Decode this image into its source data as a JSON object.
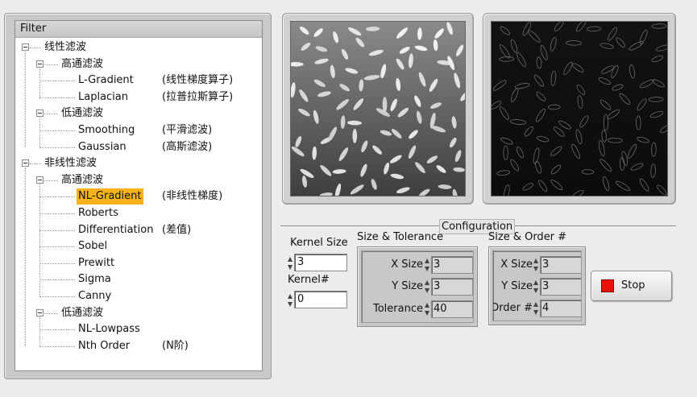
{
  "filter": {
    "header": "Filter",
    "tree": [
      {
        "level": 0,
        "label": "线性滤波",
        "desc": "",
        "expander": true,
        "selected": false
      },
      {
        "level": 1,
        "label": "高通滤波",
        "desc": "",
        "expander": true,
        "selected": false
      },
      {
        "level": 2,
        "label": "L-Gradient",
        "desc": "(线性梯度算子)",
        "expander": false,
        "selected": false
      },
      {
        "level": 2,
        "label": "Laplacian",
        "desc": "(拉普拉斯算子)",
        "expander": false,
        "selected": false
      },
      {
        "level": 1,
        "label": "低通滤波",
        "desc": "",
        "expander": true,
        "selected": false
      },
      {
        "level": 2,
        "label": "Smoothing",
        "desc": "(平滑滤波)",
        "expander": false,
        "selected": false
      },
      {
        "level": 2,
        "label": "Gaussian",
        "desc": "(高斯滤波)",
        "expander": false,
        "selected": false
      },
      {
        "level": 0,
        "label": "非线性滤波",
        "desc": "",
        "expander": true,
        "selected": false
      },
      {
        "level": 1,
        "label": "高通滤波",
        "desc": "",
        "expander": true,
        "selected": false
      },
      {
        "level": 2,
        "label": "NL-Gradient",
        "desc": "(非线性梯度)",
        "expander": false,
        "selected": true
      },
      {
        "level": 2,
        "label": "Roberts",
        "desc": "",
        "expander": false,
        "selected": false
      },
      {
        "level": 2,
        "label": "Differentiation",
        "desc": "(差值)",
        "expander": false,
        "selected": false
      },
      {
        "level": 2,
        "label": "Sobel",
        "desc": "",
        "expander": false,
        "selected": false
      },
      {
        "level": 2,
        "label": "Prewitt",
        "desc": "",
        "expander": false,
        "selected": false
      },
      {
        "level": 2,
        "label": "Sigma",
        "desc": "",
        "expander": false,
        "selected": false
      },
      {
        "level": 2,
        "label": "Canny",
        "desc": "",
        "expander": false,
        "selected": false
      },
      {
        "level": 1,
        "label": "低通滤波",
        "desc": "",
        "expander": true,
        "selected": false
      },
      {
        "level": 2,
        "label": "NL-Lowpass",
        "desc": "",
        "expander": false,
        "selected": false
      },
      {
        "level": 2,
        "label": "Nth Order",
        "desc": "(N阶)",
        "expander": false,
        "selected": false
      }
    ]
  },
  "images": {
    "original_desc": "grayscale rice grains image",
    "filtered_desc": "edge-detected dark image"
  },
  "configuration": {
    "label": "Configuration",
    "kernel_size": {
      "label": "Kernel Size",
      "value": "3"
    },
    "kernel_num": {
      "label": "Kernel#",
      "value": "0"
    },
    "size_tolerance": {
      "label": "Size & Tolerance",
      "x_size": {
        "label": "X Size",
        "value": "3"
      },
      "y_size": {
        "label": "Y Size",
        "value": "3"
      },
      "tolerance": {
        "label": "Tolerance",
        "value": "40"
      }
    },
    "size_order": {
      "label": "Size & Order #",
      "x_size": {
        "label": "X Size",
        "value": "3"
      },
      "y_size": {
        "label": "Y Size",
        "value": "3"
      },
      "order": {
        "label": "Order #",
        "value": "4"
      }
    },
    "stop_label": "Stop"
  },
  "colors": {
    "selection": "#f6b21b",
    "stop_led": "#e8120a"
  }
}
